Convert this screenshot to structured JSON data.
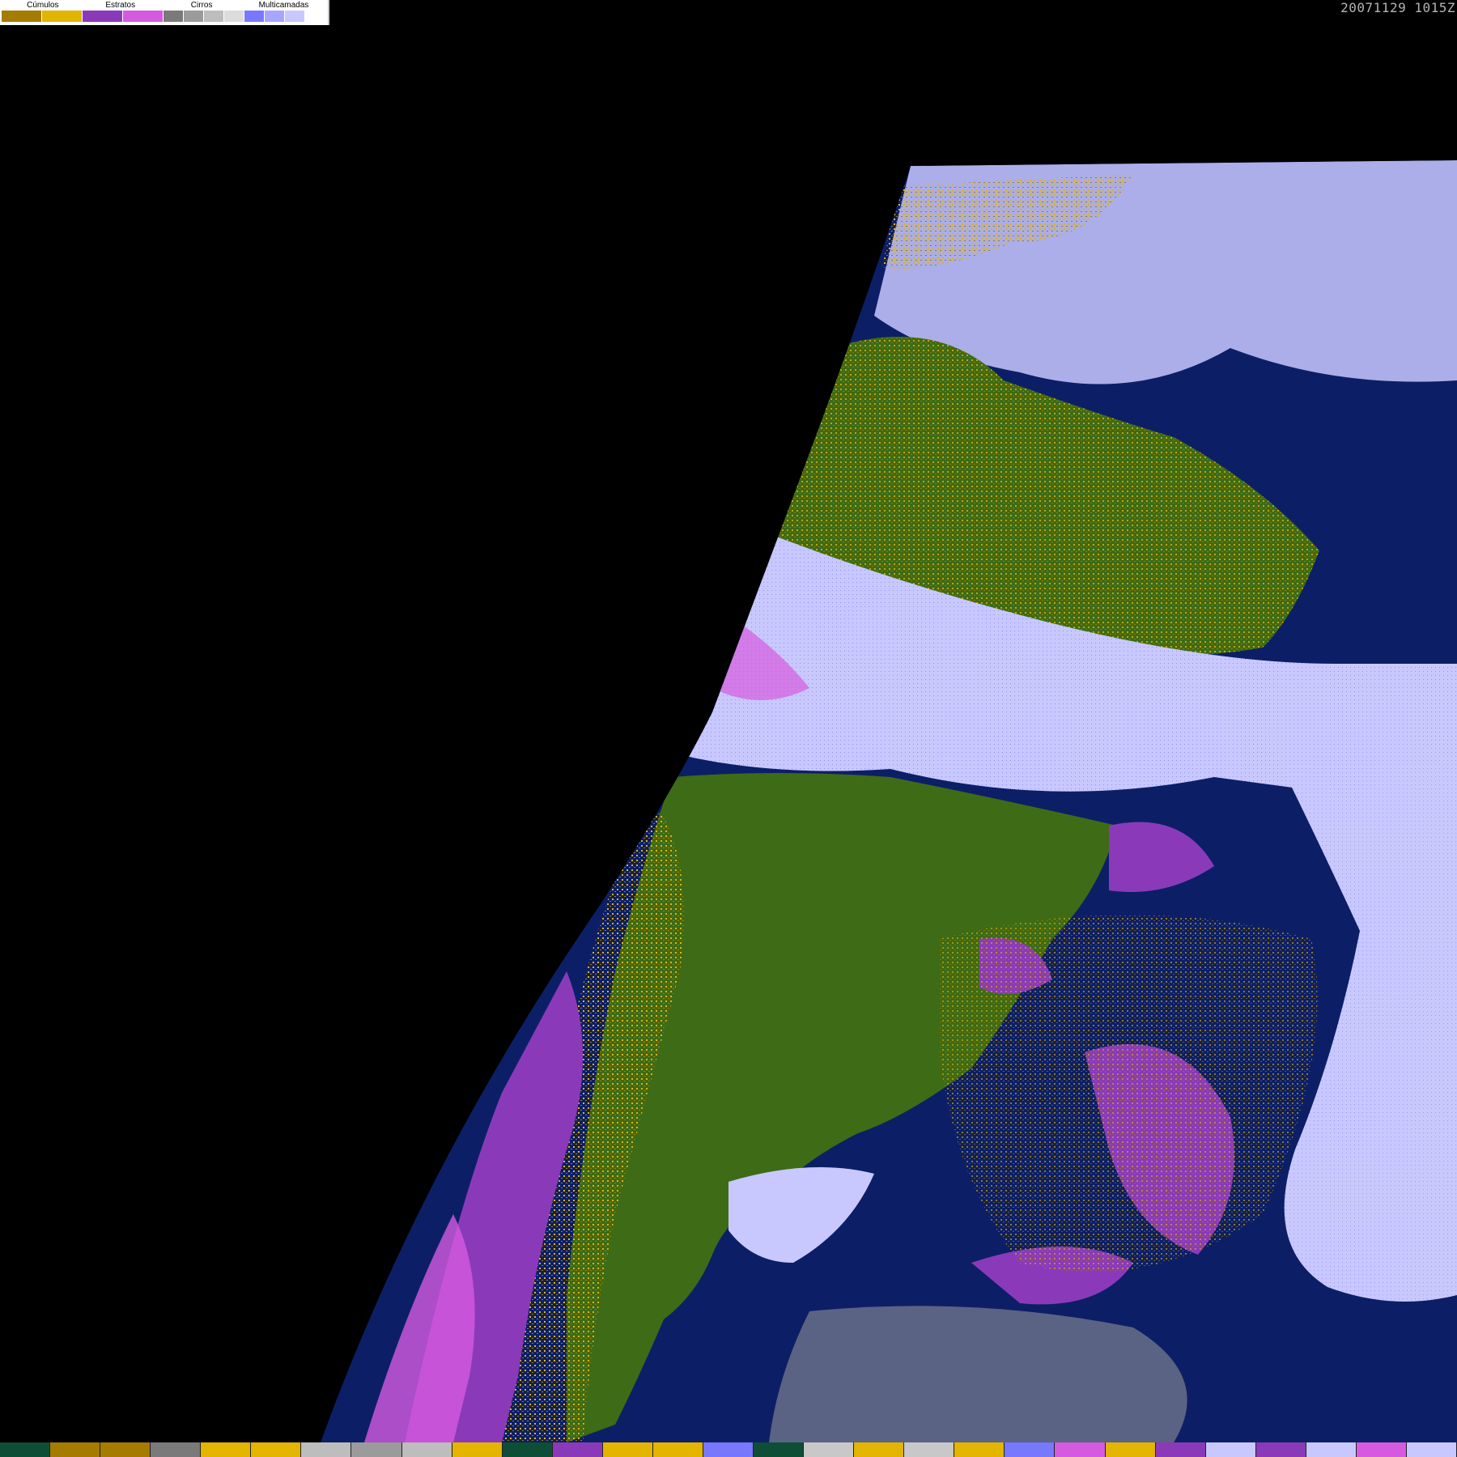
{
  "timestamp": "20071129 1015Z",
  "legend": {
    "groups": [
      {
        "label": "Cúmulos",
        "colors": [
          "#a57c00",
          "#e3b400"
        ]
      },
      {
        "label": "Estratos",
        "colors": [
          "#8a3ab9",
          "#d55ae0"
        ]
      },
      {
        "label": "Cirros",
        "colors": [
          "#7a7a7a",
          "#9b9b9b",
          "#bdbdbd",
          "#dcdcdc"
        ]
      },
      {
        "label": "Multicamadas",
        "colors": [
          "#7878ff",
          "#a6a6ff",
          "#c8c8ff",
          "#ffffff"
        ]
      }
    ]
  },
  "map": {
    "space_color": "#000000",
    "ocean_color": "#0c1f66",
    "land_color": "#3e6b15"
  },
  "bottom_strip": {
    "colors": [
      "#0e4e37",
      "#a57c00",
      "#a57c00",
      "#7a7a7a",
      "#e3b400",
      "#e3b400",
      "#bdbdbd",
      "#9b9b9b",
      "#bdbdbd",
      "#e3b400",
      "#0e4e37",
      "#8a3ab9",
      "#e3b400",
      "#e3b400",
      "#7878ff",
      "#0e4e37",
      "#c8c8c8",
      "#e3b400",
      "#c8c8c8",
      "#e3b400",
      "#7878ff",
      "#d55ae0",
      "#e3b400",
      "#8a3ab9",
      "#c8c8ff",
      "#8a3ab9",
      "#c8c8ff",
      "#d55ae0",
      "#c8c8ff"
    ]
  }
}
